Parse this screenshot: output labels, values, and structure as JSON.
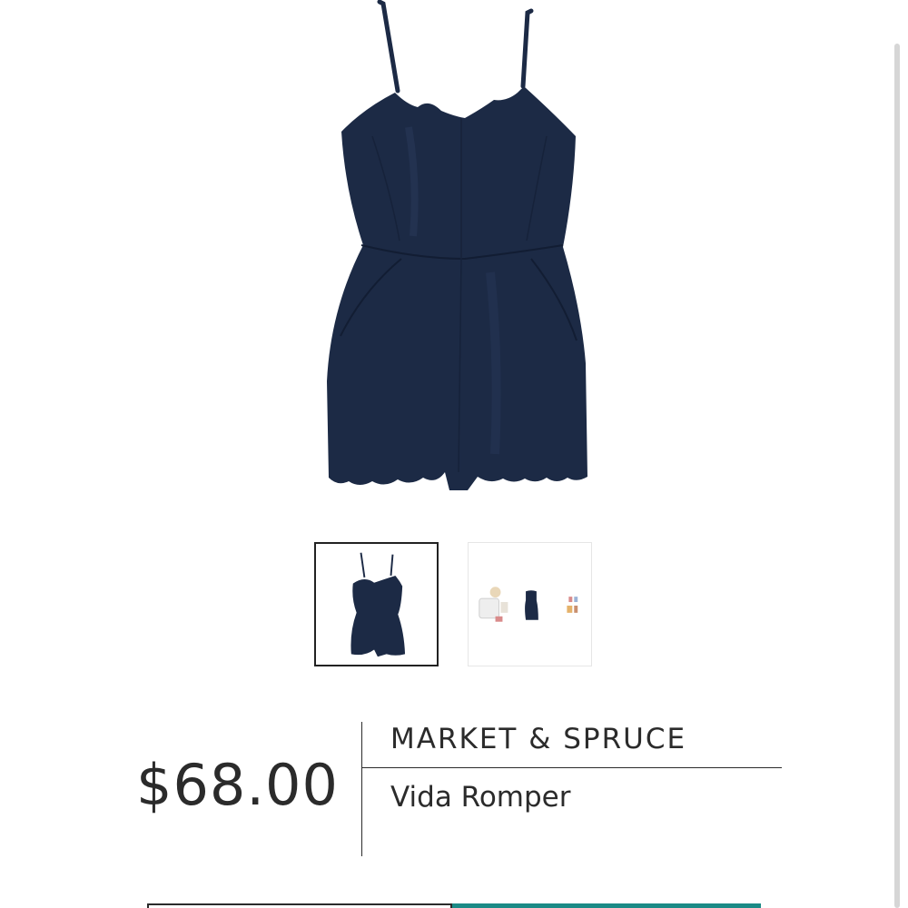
{
  "product": {
    "price": "$68.00",
    "brand": "MARKET & SPRUCE",
    "name": "Vida Romper",
    "garment_color": "#1c2a45"
  },
  "gallery": {
    "thumbnails": [
      {
        "name": "romper-front-photo",
        "selected": true
      },
      {
        "name": "outfit-styling-photo",
        "selected": false
      }
    ]
  },
  "colors": {
    "accent": "#1b8a86",
    "text": "#2b2b2b",
    "scrollbar": "#d6d6d6"
  }
}
